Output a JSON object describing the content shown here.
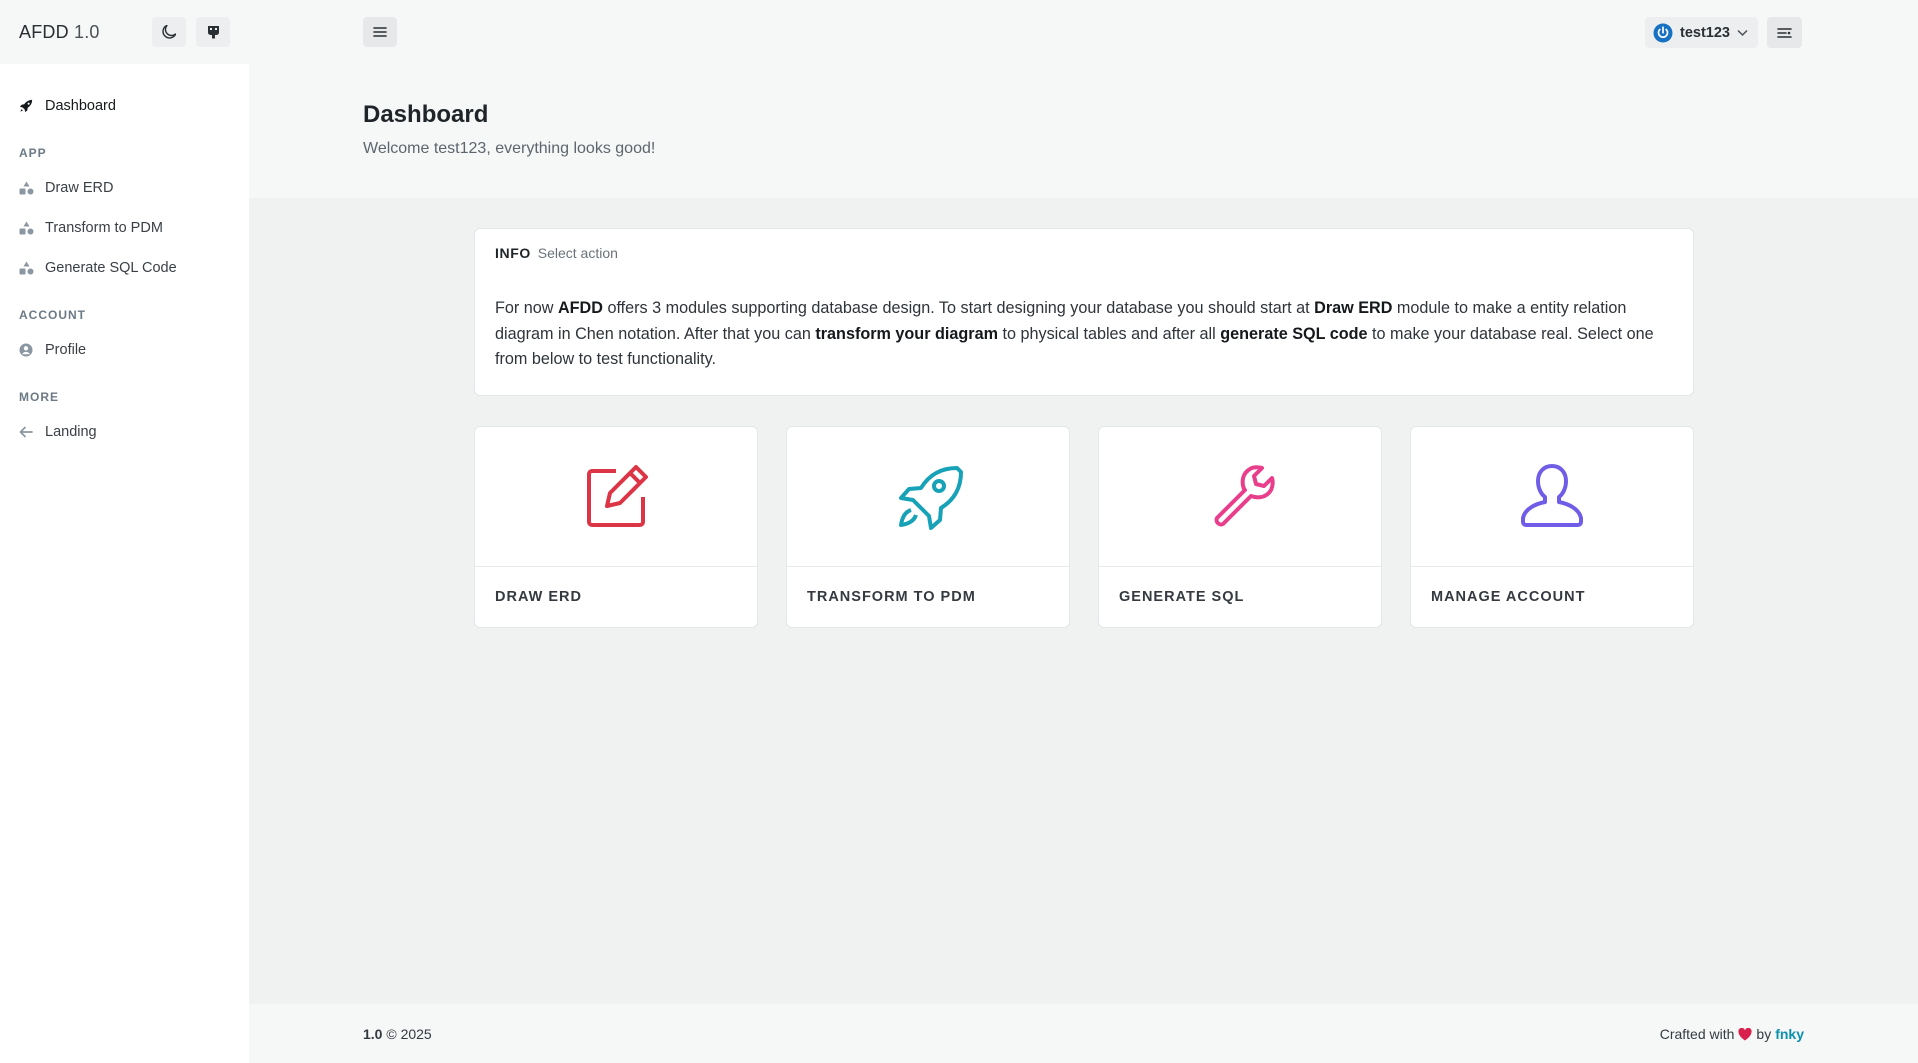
{
  "sidebar": {
    "brand": "AFDD",
    "version": "1.0",
    "theme_toggle_icon": "moon-icon",
    "github_icon": "github-icon",
    "dashboard_label": "Dashboard",
    "sections": {
      "app": {
        "heading": "APP",
        "items": [
          "Draw ERD",
          "Transform to PDM",
          "Generate SQL Code"
        ]
      },
      "account": {
        "heading": "ACCOUNT",
        "items": [
          "Profile"
        ]
      },
      "more": {
        "heading": "MORE",
        "items": [
          "Landing"
        ]
      }
    }
  },
  "topbar": {
    "menu_icon": "hamburger-icon",
    "username": "test123",
    "options_icon": "options-icon"
  },
  "hero": {
    "title": "Dashboard",
    "subtitle": "Welcome test123, everything looks good!"
  },
  "info": {
    "label": "INFO",
    "sub_label": "Select action",
    "text": {
      "t1": "For now ",
      "b1": "AFDD",
      "t2": " offers 3 modules supporting database design. To start designing your database you should start at ",
      "b2": "Draw ERD",
      "t3": " module to make a entity relation diagram in Chen notation. After that you can ",
      "b3": "transform your diagram",
      "t4": " to physical tables and after all ",
      "b4": "generate SQL code",
      "t5": " to make your database real. Select one from below to test functionality."
    }
  },
  "cards": [
    {
      "label": "DRAW ERD",
      "icon": "edit-icon",
      "color": "#dc3545"
    },
    {
      "label": "TRANSFORM TO PDM",
      "icon": "rocket-icon",
      "color": "#17a2b8"
    },
    {
      "label": "GENERATE SQL",
      "icon": "wrench-icon",
      "color": "#e83e8c"
    },
    {
      "label": "MANAGE ACCOUNT",
      "icon": "user-icon",
      "color": "#6f5de7"
    }
  ],
  "footer": {
    "version": "1.0",
    "year": "© 2025",
    "crafted": "Crafted with",
    "by": "by",
    "author": "fnky",
    "heart_color": "#d9214e"
  }
}
